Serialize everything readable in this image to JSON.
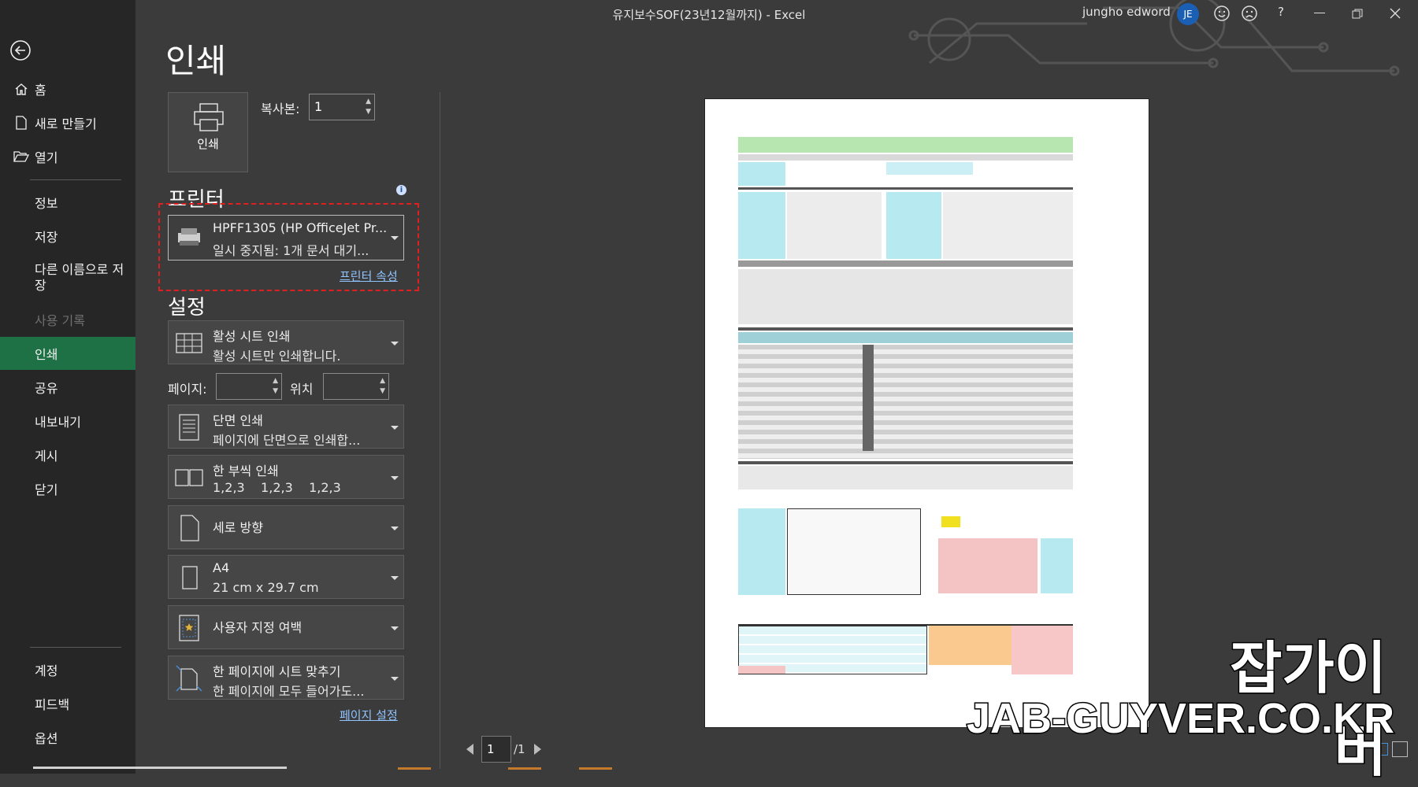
{
  "titlebar": {
    "title": "유지보수SOF(23년12월까지)  -  Excel",
    "user": "jungho edword",
    "avatar": "JE",
    "help": "?"
  },
  "sidebar": {
    "items": [
      {
        "label": "홈"
      },
      {
        "label": "새로 만들기"
      },
      {
        "label": "열기"
      },
      {
        "label": "정보"
      },
      {
        "label": "저장"
      },
      {
        "label": "다른 이름으로 저장"
      },
      {
        "label": "사용 기록"
      },
      {
        "label": "인쇄"
      },
      {
        "label": "공유"
      },
      {
        "label": "내보내기"
      },
      {
        "label": "게시"
      },
      {
        "label": "닫기"
      },
      {
        "label": "계정"
      },
      {
        "label": "피드백"
      },
      {
        "label": "옵션"
      }
    ]
  },
  "print": {
    "title": "인쇄",
    "print_button": "인쇄",
    "copies_label": "복사본:",
    "copies_value": "1",
    "printer_header": "프린터",
    "printer_name": "HPFF1305 (HP OfficeJet Pr...",
    "printer_status": "일시 중지됨: 1개 문서 대기...",
    "printer_props": "프린터 속성",
    "settings_header": "설정",
    "settings": [
      {
        "l1": "활성 시트 인쇄",
        "l2": "활성 시트만 인쇄합니다."
      },
      {
        "l1": "단면 인쇄",
        "l2": "페이지에 단면으로 인쇄합..."
      },
      {
        "l1": "한 부씩 인쇄",
        "l2": "1,2,3    1,2,3    1,2,3"
      },
      {
        "l1": "세로 방향",
        "l2": ""
      },
      {
        "l1": "A4",
        "l2": "21 cm x 29.7 cm"
      },
      {
        "l1": "사용자 지정 여백",
        "l2": ""
      },
      {
        "l1": "한 페이지에 시트 맞추기",
        "l2": "한 페이지에 모두 들어가도..."
      }
    ],
    "pages_label": "페이지:",
    "pages_to_label": "위치",
    "page_setup": "페이지 설정"
  },
  "preview": {
    "page_current": "1",
    "page_total": "/1"
  },
  "watermark": {
    "line1": "잡가이버",
    "line2": "JAB-GUYVER.CO.KR"
  },
  "colors": {
    "sidebar": "#262626",
    "active": "#1e7145",
    "main": "#3b3b3b",
    "highlight": "#e02020"
  }
}
